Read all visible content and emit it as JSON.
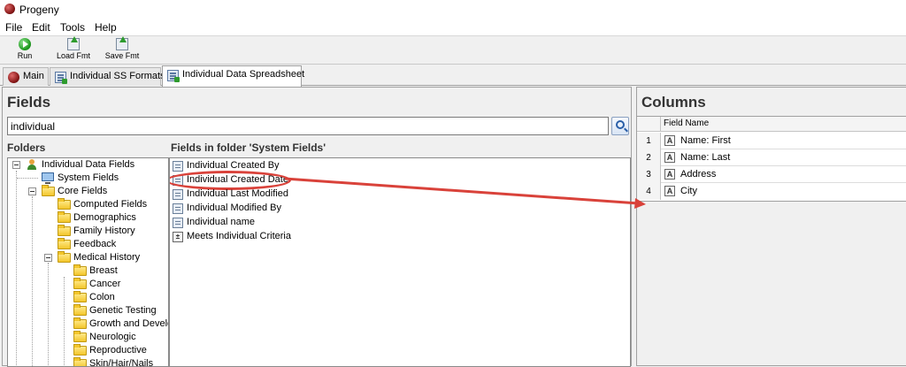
{
  "window": {
    "title": "Progeny"
  },
  "menu": [
    "File",
    "Edit",
    "Tools",
    "Help"
  ],
  "toolbar": {
    "run_label": "Run",
    "load_label": "Load Fmt",
    "save_label": "Save Fmt"
  },
  "tabs": [
    {
      "label": "Main",
      "icon": "progeny-icon"
    },
    {
      "label": "Individual SS Formats",
      "icon": "spreadsheet-icon"
    },
    {
      "label": "Individual Data Spreadsheet",
      "icon": "spreadsheet-icon",
      "active": true
    }
  ],
  "fields_panel": {
    "title": "Fields",
    "search_value": "individual",
    "folders_label": "Folders",
    "list_label": "Fields in folder 'System Fields'"
  },
  "folders": [
    {
      "label": "Individual Data Fields",
      "icon": "person-icon"
    },
    {
      "label": "System Fields",
      "icon": "monitor-icon"
    },
    {
      "label": "Core Fields",
      "icon": "folder-icon"
    },
    {
      "label": "Computed Fields",
      "icon": "folder-icon"
    },
    {
      "label": "Demographics",
      "icon": "folder-icon"
    },
    {
      "label": "Family History",
      "icon": "folder-icon"
    },
    {
      "label": "Feedback",
      "icon": "folder-icon"
    },
    {
      "label": "Medical History",
      "icon": "folder-icon"
    },
    {
      "label": "Breast",
      "icon": "folder-icon"
    },
    {
      "label": "Cancer",
      "icon": "folder-icon"
    },
    {
      "label": "Colon",
      "icon": "folder-icon"
    },
    {
      "label": "Genetic Testing",
      "icon": "folder-icon"
    },
    {
      "label": "Growth and Develop",
      "icon": "folder-icon"
    },
    {
      "label": "Neurologic",
      "icon": "folder-icon"
    },
    {
      "label": "Reproductive",
      "icon": "folder-icon"
    },
    {
      "label": "Skin/Hair/Nails",
      "icon": "folder-icon"
    }
  ],
  "fields": [
    {
      "label": "Individual Created By",
      "icon": "field-icon"
    },
    {
      "label": "Individual Created Date",
      "icon": "field-icon",
      "highlighted": true
    },
    {
      "label": "Individual Last Modified",
      "icon": "field-icon"
    },
    {
      "label": "Individual Modified By",
      "icon": "field-icon"
    },
    {
      "label": "Individual name",
      "icon": "field-icon"
    },
    {
      "label": "Meets Individual Criteria",
      "icon": "criteria-icon"
    }
  ],
  "columns_panel": {
    "title": "Columns",
    "header_field_name": "Field Name",
    "rows": [
      {
        "num": "1",
        "type_glyph": "A",
        "name": "Name: First"
      },
      {
        "num": "2",
        "type_glyph": "A",
        "name": "Name: Last"
      },
      {
        "num": "3",
        "type_glyph": "A",
        "name": "Address"
      },
      {
        "num": "4",
        "type_glyph": "A",
        "name": "City"
      }
    ]
  },
  "colors": {
    "annotation": "#d9423a",
    "tab_active": "#ffffff",
    "toolbar_bg": "#f0f0f0"
  }
}
